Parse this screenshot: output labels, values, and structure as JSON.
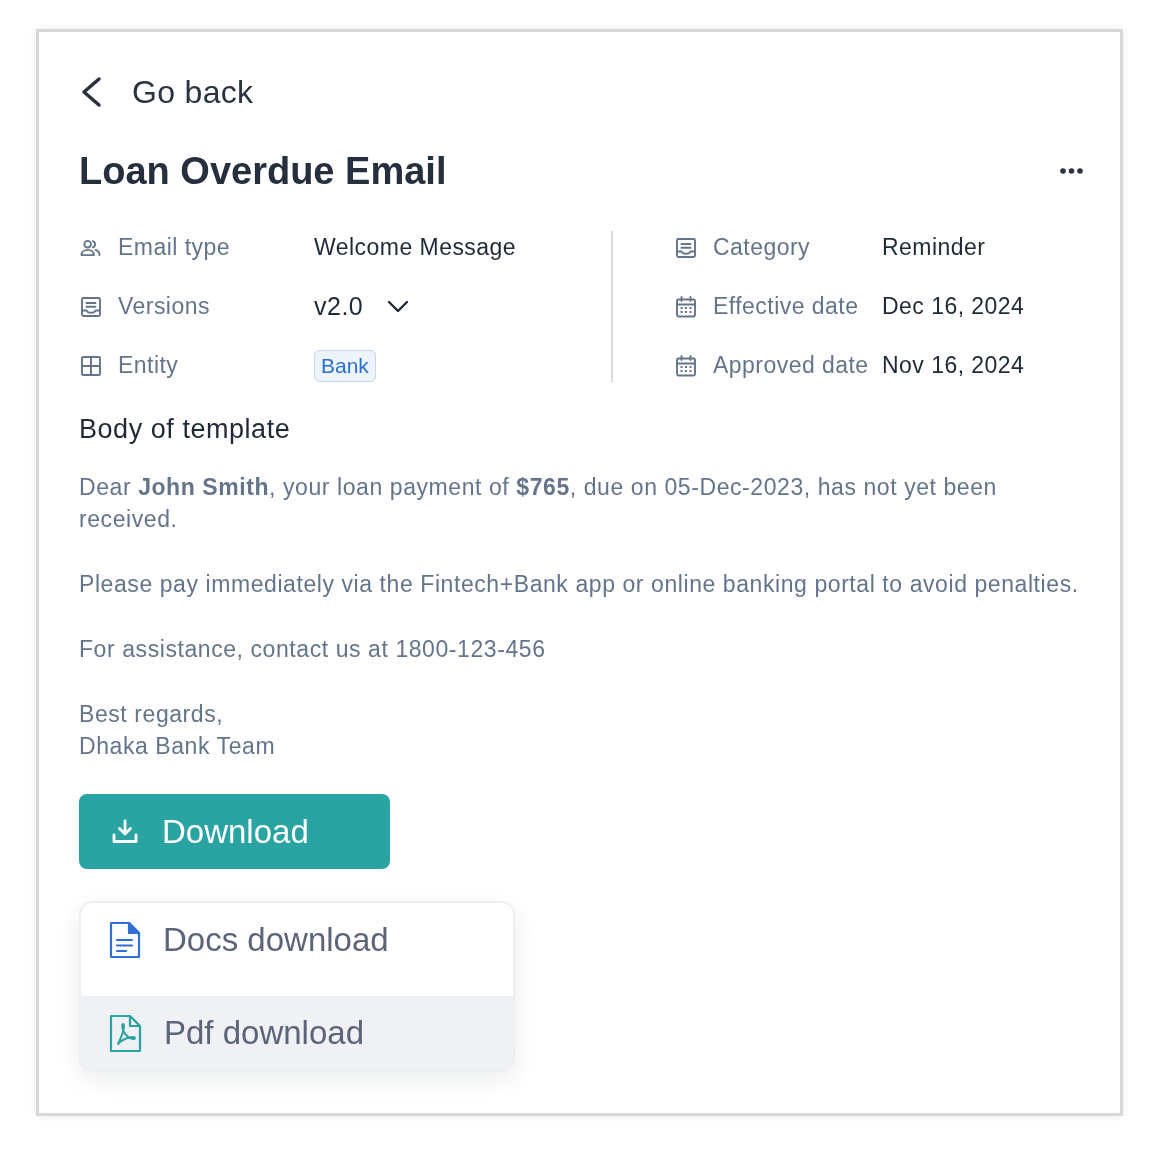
{
  "back_link": {
    "label": "Go back"
  },
  "title": "Loan Overdue Email",
  "details": {
    "left": [
      {
        "label": "Email type",
        "value": "Welcome Message",
        "kind": "text"
      },
      {
        "label": "Versions",
        "value": "v2.0",
        "kind": "select"
      },
      {
        "label": "Entity",
        "value": "Bank",
        "kind": "badge"
      }
    ],
    "right": [
      {
        "label": "Category",
        "value": "Reminder",
        "kind": "text"
      },
      {
        "label": "Effective date",
        "value": "Dec 16, 2024",
        "kind": "text"
      },
      {
        "label": "Approved date",
        "value": "Nov 16, 2024",
        "kind": "text"
      }
    ]
  },
  "body": {
    "title": "Body of template",
    "paragraphs": [
      {
        "lines": [
          "Dear **John Smith**, your loan payment of **$765**, due on 05-Dec-2023, has not yet been received."
        ]
      },
      {
        "lines": [
          "Please pay immediately via the Fintech+Bank app or online banking portal to avoid penalties."
        ]
      },
      {
        "lines": [
          "For assistance, contact us at 1800-123-456"
        ]
      },
      {
        "lines": [
          "Best regards,",
          "Dhaka Bank Team"
        ]
      }
    ]
  },
  "download_button": {
    "label": "Download"
  },
  "download_menu": {
    "items": [
      {
        "label": "Docs download",
        "highlighted": false
      },
      {
        "label": "Pdf download",
        "highlighted": true
      }
    ]
  }
}
